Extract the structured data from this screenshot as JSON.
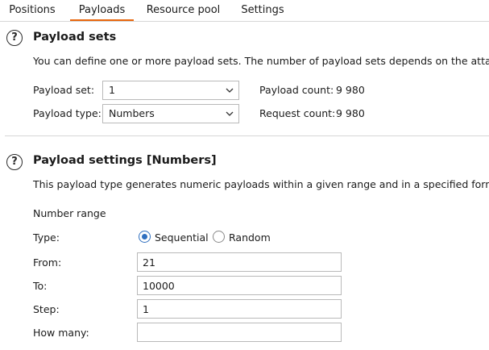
{
  "tabs": [
    {
      "label": "Positions"
    },
    {
      "label": "Payloads",
      "active": true
    },
    {
      "label": "Resource pool"
    },
    {
      "label": "Settings"
    }
  ],
  "payload_sets": {
    "help_icon": "?",
    "title": "Payload sets",
    "description": "You can define one or more payload sets. The number of payload sets depends on the attack ty",
    "payload_set_label": "Payload set:",
    "payload_set_value": "1",
    "payload_type_label": "Payload type:",
    "payload_type_value": "Numbers",
    "payload_count_label": "Payload count:",
    "payload_count_value": "9 980",
    "request_count_label": "Request count:",
    "request_count_value": "9 980"
  },
  "payload_settings": {
    "help_icon": "?",
    "title": "Payload settings [Numbers]",
    "description": "This payload type generates numeric payloads within a given range and in a specified format.",
    "number_range_label": "Number range",
    "type_label": "Type:",
    "type_options": [
      "Sequential",
      "Random"
    ],
    "type_selected": "Sequential",
    "from_label": "From:",
    "from_value": "21",
    "to_label": "To:",
    "to_value": "10000",
    "step_label": "Step:",
    "step_value": "1",
    "how_many_label": "How many:",
    "how_many_value": ""
  },
  "colors": {
    "accent_tab": "#e8660c",
    "radio_selected": "#2f6fbf"
  }
}
